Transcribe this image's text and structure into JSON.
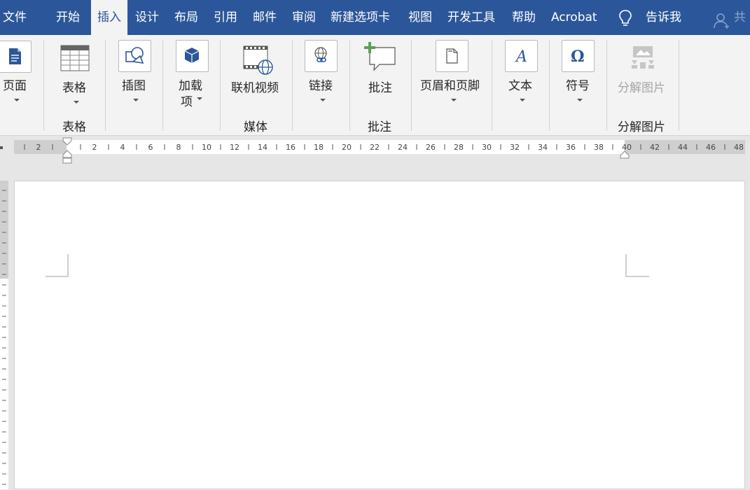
{
  "tabs": [
    {
      "label": "文件",
      "active": false
    },
    {
      "label": "开始",
      "active": false
    },
    {
      "label": "插入",
      "active": true
    },
    {
      "label": "设计",
      "active": false
    },
    {
      "label": "布局",
      "active": false
    },
    {
      "label": "引用",
      "active": false
    },
    {
      "label": "邮件",
      "active": false
    },
    {
      "label": "审阅",
      "active": false
    },
    {
      "label": "新建选项卡",
      "active": false
    },
    {
      "label": "视图",
      "active": false
    },
    {
      "label": "开发工具",
      "active": false
    },
    {
      "label": "帮助",
      "active": false
    },
    {
      "label": "Acrobat",
      "active": false
    }
  ],
  "tell_me": "告诉我",
  "share_label": "共",
  "ribbon": {
    "pages": "页面",
    "table": "表格",
    "illustrations": "插图",
    "addins_line1": "加载",
    "addins_line2": "项",
    "online_video": "联机视频",
    "links": "链接",
    "comment": "批注",
    "header_footer": "页眉和页脚",
    "text": "文本",
    "symbols": "符号",
    "split_image": "分解图片"
  },
  "groups": {
    "tables": "表格",
    "media": "媒体",
    "comments": "批注",
    "split_image": "分解图片"
  },
  "ruler": {
    "labels": [
      "2",
      "2",
      "4",
      "6",
      "8",
      "10",
      "12",
      "14",
      "16",
      "18",
      "20",
      "22",
      "24",
      "26",
      "28",
      "30",
      "32",
      "34",
      "36",
      "38",
      "40",
      "42",
      "44",
      "46",
      "48"
    ]
  },
  "colors": {
    "accent": "#2b579a",
    "ribbon_bg": "#f3f3f3",
    "canvas_bg": "#e6e6e6"
  }
}
